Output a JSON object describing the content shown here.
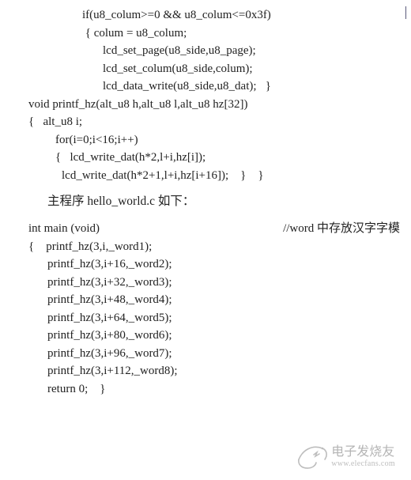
{
  "block1": {
    "l1": "if(u8_colum>=0 && u8_colum<=0x3f)",
    "l2": " { colum = u8_colum;",
    "l3": "lcd_set_page(u8_side,u8_page);",
    "l4": "lcd_set_colum(u8_side,colum);",
    "l5": "lcd_data_write(u8_side,u8_dat);   }"
  },
  "block2": {
    "l1": "void printf_hz(alt_u8 h,alt_u8 l,alt_u8 hz[32])",
    "l2": "{   alt_u8 i;",
    "l3": "for(i=0;i<16;i++)",
    "l4": "{   lcd_write_dat(h*2,l+i,hz[i]);",
    "l5": "lcd_write_dat(h*2+1,l+i,hz[i+16]);    }    }"
  },
  "zh": "主程序 hello_world.c 如下：",
  "block3": {
    "l1": "int main (void)",
    "comment": "//word 中存放汉字字模",
    "l2": "{    printf_hz(3,i,_word1);",
    "l3": "printf_hz(3,i+16,_word2);",
    "l4": "printf_hz(3,i+32,_word3);",
    "l5": "printf_hz(3,i+48,_word4);",
    "l6": "printf_hz(3,i+64,_word5);",
    "l7": "printf_hz(3,i+80,_word6);",
    "l8": "printf_hz(3,i+96,_word7);",
    "l9": "printf_hz(3,i+112,_word8);",
    "l10": "return 0;    }"
  },
  "watermark": {
    "name": "电子发烧友",
    "url": "www.elecfans.com"
  }
}
